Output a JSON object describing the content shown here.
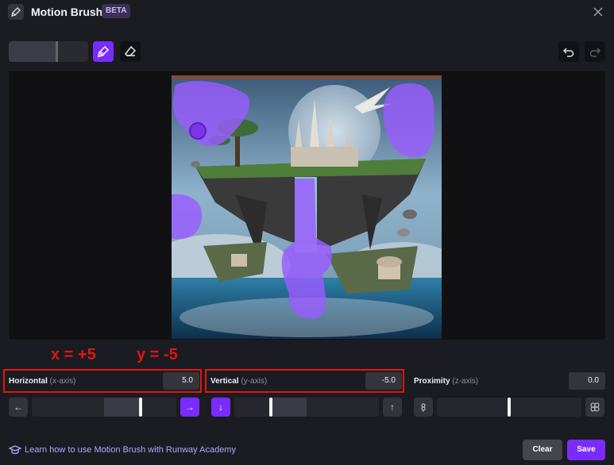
{
  "header": {
    "title": "Motion Brush",
    "badge": "BETA",
    "icons": {
      "app": "brush-app-icon",
      "close": "close-icon"
    }
  },
  "toolbar": {
    "brush_size_percent": 62,
    "active_tool": "brush",
    "icons": [
      "brush-icon",
      "eraser-icon",
      "undo-icon",
      "redo-icon"
    ]
  },
  "annotations": {
    "x_note": "x = +5",
    "y_note": "y = -5",
    "color": "#e0160e"
  },
  "controls": {
    "horizontal": {
      "label": "Horizontal",
      "sub": "(x-axis)",
      "value": "5.0",
      "level": 5.0
    },
    "vertical": {
      "label": "Vertical",
      "sub": "(y-axis)",
      "value": "-5.0",
      "level": -5.0
    },
    "proximity": {
      "label": "Proximity",
      "sub": "(z-axis)",
      "value": "0.0",
      "level": 0.0
    }
  },
  "footer": {
    "learn_link": "Learn how to use Motion Brush with Runway Academy",
    "clear_label": "Clear",
    "save_label": "Save"
  },
  "colors": {
    "accent": "#7a2bff",
    "background": "#1b1c21",
    "brush_paint": "#9a5cff"
  }
}
